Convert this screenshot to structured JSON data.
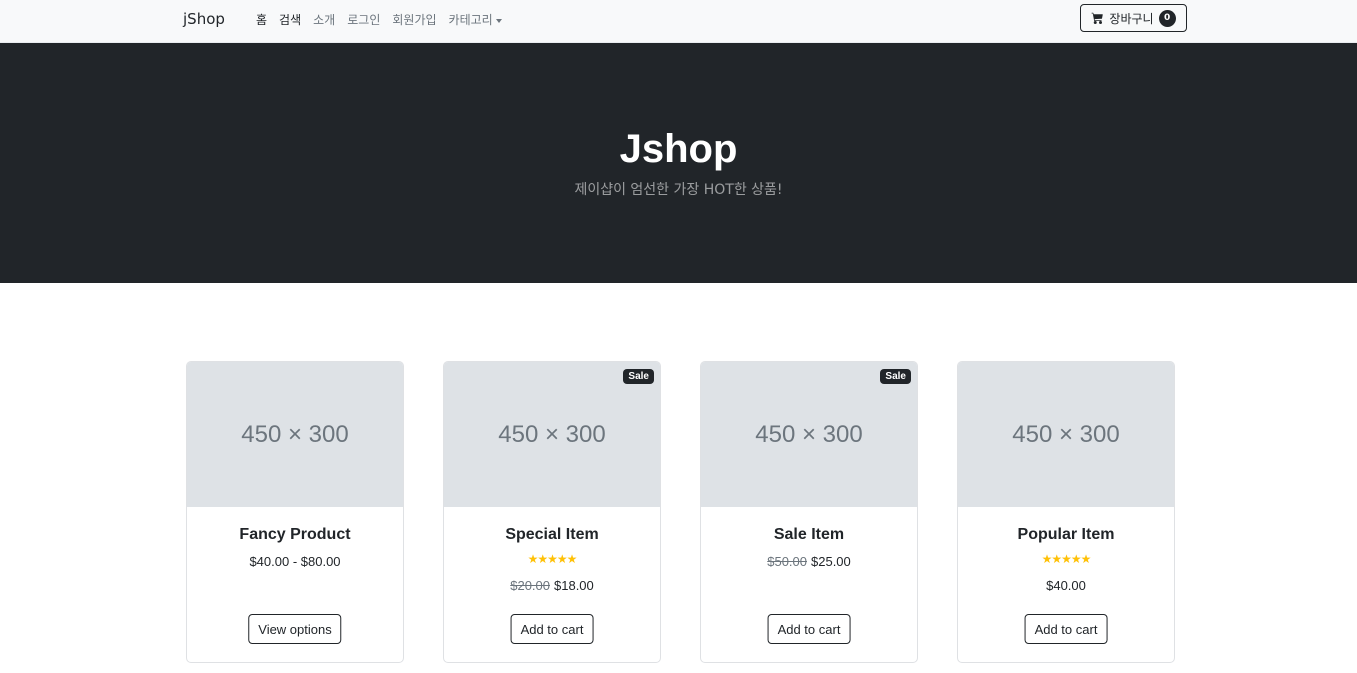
{
  "navbar": {
    "brand": "jShop",
    "items": [
      {
        "label": "홈",
        "active": true
      },
      {
        "label": "검색",
        "active": true
      },
      {
        "label": "소개",
        "active": false
      },
      {
        "label": "로그인",
        "active": false
      },
      {
        "label": "회원가입",
        "active": false
      },
      {
        "label": "카테고리",
        "active": false,
        "dropdown": true
      }
    ],
    "cart": {
      "label": "장바구니",
      "count": "0",
      "icon": "cart-icon"
    }
  },
  "hero": {
    "title": "Jshop",
    "subtitle": "제이샵이 엄선한 가장 HOT한 상품!"
  },
  "products": [
    {
      "image_text": "450 × 300",
      "badge": "",
      "name": "Fancy Product",
      "rating": 0,
      "stars": "",
      "old_price": "",
      "price": "$40.00 - $80.00",
      "button": "View options"
    },
    {
      "image_text": "450 × 300",
      "badge": "Sale",
      "name": "Special Item",
      "rating": 5,
      "stars": "★★★★★",
      "old_price": "$20.00",
      "price": "$18.00",
      "button": "Add to cart"
    },
    {
      "image_text": "450 × 300",
      "badge": "Sale",
      "name": "Sale Item",
      "rating": 0,
      "stars": "",
      "old_price": "$50.00",
      "price": "$25.00",
      "button": "Add to cart"
    },
    {
      "image_text": "450 × 300",
      "badge": "",
      "name": "Popular Item",
      "rating": 5,
      "stars": "★★★★★",
      "old_price": "",
      "price": "$40.00",
      "button": "Add to cart"
    }
  ],
  "colors": {
    "hero_bg": "#212529",
    "navbar_bg": "#f8f9fa",
    "star": "#ffc107",
    "placeholder": "#dee2e6"
  }
}
